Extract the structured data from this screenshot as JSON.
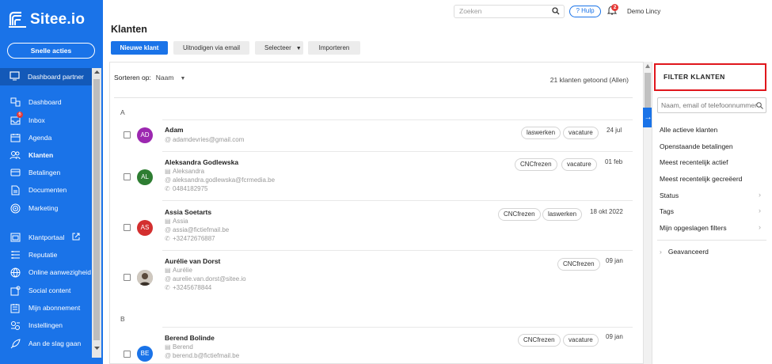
{
  "brand": {
    "name": "Sitee.io",
    "accent": "#1a73e8"
  },
  "sidebar": {
    "quick_actions": "Snelle acties",
    "partner": "Dashboard partner",
    "items": [
      {
        "label": "Dashboard",
        "icon": "dashboard-icon"
      },
      {
        "label": "Inbox",
        "icon": "inbox-icon",
        "badge": "6"
      },
      {
        "label": "Agenda",
        "icon": "calendar-icon"
      },
      {
        "label": "Klanten",
        "icon": "customers-icon"
      },
      {
        "label": "Betalingen",
        "icon": "payments-icon"
      },
      {
        "label": "Documenten",
        "icon": "documents-icon"
      },
      {
        "label": "Marketing",
        "icon": "marketing-icon"
      },
      {
        "label": "Klantportaal",
        "icon": "portal-icon"
      },
      {
        "label": "Reputatie",
        "icon": "reputation-icon"
      },
      {
        "label": "Online aanwezigheid",
        "icon": "globe-icon"
      },
      {
        "label": "Social content",
        "icon": "social-icon"
      },
      {
        "label": "Mijn abonnement",
        "icon": "subscription-icon"
      },
      {
        "label": "Instellingen",
        "icon": "settings-icon"
      },
      {
        "label": "Aan de slag gaan",
        "icon": "rocket-icon"
      }
    ]
  },
  "topbar": {
    "search_placeholder": "Zoeken",
    "help": "? Hulp",
    "notifications": "2",
    "user": "Demo Lincy"
  },
  "page": {
    "title": "Klanten",
    "buttons": {
      "new": "Nieuwe klant",
      "invite": "Uitnodigen via email",
      "select": "Selecteer",
      "import": "Importeren"
    },
    "sort_label": "Sorteren op:",
    "sort_value": "Naam",
    "count": "21 klanten getoond (Allen)",
    "groups": [
      "A",
      "B"
    ],
    "customers": [
      {
        "initials": "AD",
        "color": "#9c27b0",
        "name": "Adam",
        "company": "",
        "email": "adamdevries@gmail.com",
        "phone": "",
        "tags": [
          "laswerken",
          "vacature"
        ],
        "date": "24 jul"
      },
      {
        "initials": "AL",
        "color": "#2e7d32",
        "name": "Aleksandra Godlewska",
        "company": "Aleksandra",
        "email": "aleksandra.godlewska@fcrmedia.be",
        "phone": "0484182975",
        "tags": [
          "CNCfrezen",
          "vacature"
        ],
        "date": "01 feb"
      },
      {
        "initials": "AS",
        "color": "#d32f2f",
        "name": "Assia Soetarts",
        "company": "Assia",
        "email": "assia@fictiefmail.be",
        "phone": "+32472676887",
        "tags": [
          "CNCfrezen",
          "laswerken"
        ],
        "date": "18 okt 2022"
      },
      {
        "initials": "",
        "color": "#8d8d8d",
        "name": "Aurélie van Dorst",
        "company": "Aurélie",
        "email": "aurelie.van.dorst@sitee.io",
        "phone": "+3245678844",
        "tags": [
          "CNCfrezen"
        ],
        "date": "09 jan"
      },
      {
        "initials": "BE",
        "color": "#1a73e8",
        "name": "Berend Bolinde",
        "company": "Berend",
        "email": "berend.b@fictiefmail.be",
        "phone": "",
        "tags": [
          "CNCfrezen",
          "vacature"
        ],
        "date": "09 jan"
      }
    ]
  },
  "filter": {
    "title": "FILTER KLANTEN",
    "search_placeholder": "Naam, email of telefoonnummer",
    "options": [
      "Alle actieve klanten",
      "Openstaande betalingen",
      "Meest recentelijk actief",
      "Meest recentelijk gecreëerd"
    ],
    "expandables": [
      "Status",
      "Tags",
      "Mijn opgeslagen filters"
    ],
    "advanced": "Geavanceerd",
    "highlight_color": "#e0161c"
  }
}
